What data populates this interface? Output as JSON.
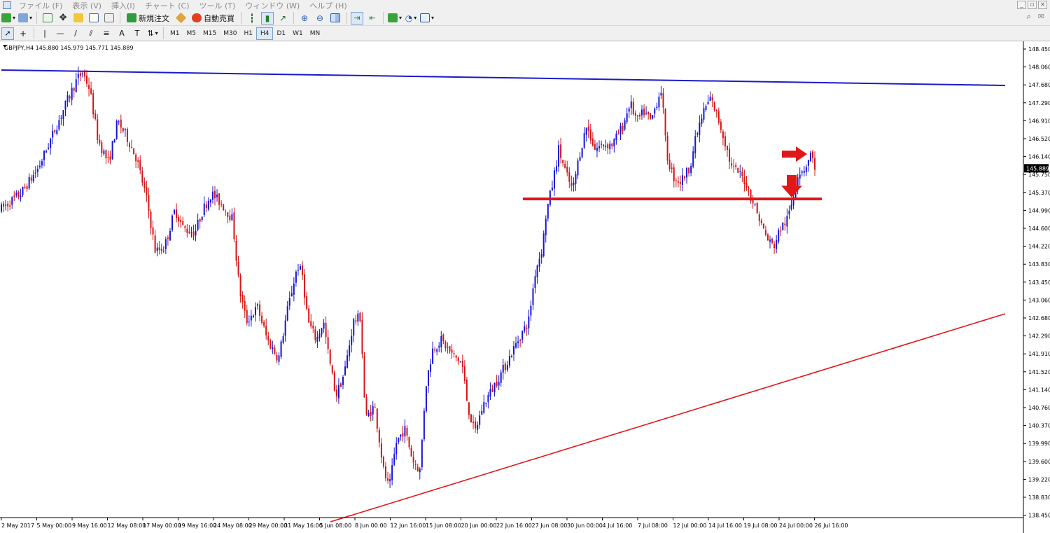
{
  "menu": {
    "items": [
      "ファイル (F)",
      "表示 (V)",
      "挿入(I)",
      "チャート (C)",
      "ツール (T)",
      "ウィンドウ (W)",
      "ヘルプ (H)"
    ]
  },
  "toolbar": {
    "new_order_label": "新規注文",
    "auto_trade_label": "自動売買"
  },
  "timeframes": [
    "M1",
    "M5",
    "M15",
    "M30",
    "H1",
    "H4",
    "D1",
    "W1",
    "MN"
  ],
  "active_timeframe": "H4",
  "chart_header": "GBPJPY,H4  145.880 145.979 145.771 145.889",
  "colors": {
    "bull": "#1414d8",
    "bear": "#d41414",
    "resistance_line": "#1a1acc",
    "support_line": "#e01818",
    "horizontal_line": "#e0141c",
    "arrow": "#e01818"
  },
  "chart_data": {
    "type": "candlestick",
    "symbol": "GBPJPY",
    "timeframe": "H4",
    "ohlc": {
      "open": 145.88,
      "high": 145.979,
      "low": 145.771,
      "close": 145.889
    },
    "current_price": "145.889",
    "y_ticks": [
      "148.450",
      "148.060",
      "147.680",
      "147.290",
      "146.910",
      "146.520",
      "146.140",
      "145.750",
      "145.370",
      "144.990",
      "144.600",
      "144.220",
      "143.830",
      "143.450",
      "143.060",
      "142.680",
      "142.290",
      "141.910",
      "141.520",
      "141.140",
      "140.760",
      "140.370",
      "139.990",
      "139.600",
      "139.220",
      "138.830",
      "138.450"
    ],
    "x_labels": [
      "2 May 2017",
      "5 May 00:00",
      "9 May 16:00",
      "12 May 08:00",
      "17 May 00:00",
      "19 May 16:00",
      "24 May 08:00",
      "29 May 00:00",
      "31 May 16:00",
      "5 Jun 08:00",
      "8 Jun 00:00",
      "12 Jun 16:00",
      "15 Jun 08:00",
      "20 Jun 00:00",
      "22 Jun 16:00",
      "27 Jun 08:00",
      "30 Jun 00:00",
      "4 Jul 16:00",
      "7 Jul 08:00",
      "12 Jul 00:00",
      "14 Jul 16:00",
      "19 Jul 08:00",
      "24 Jul 00:00",
      "26 Jul 16:00"
    ],
    "y_range": [
      138.45,
      148.45
    ],
    "price_path": [
      [
        0,
        145.0
      ],
      [
        30,
        145.35
      ],
      [
        55,
        145.9
      ],
      [
        75,
        146.6
      ],
      [
        95,
        147.3
      ],
      [
        110,
        147.8
      ],
      [
        118,
        147.95
      ],
      [
        128,
        147.6
      ],
      [
        140,
        146.5
      ],
      [
        155,
        146.0
      ],
      [
        168,
        146.9
      ],
      [
        180,
        146.6
      ],
      [
        195,
        146.1
      ],
      [
        210,
        145.2
      ],
      [
        222,
        144.1
      ],
      [
        235,
        144.2
      ],
      [
        250,
        145.0
      ],
      [
        262,
        144.6
      ],
      [
        278,
        144.5
      ],
      [
        290,
        145.0
      ],
      [
        302,
        145.35
      ],
      [
        318,
        145.1
      ],
      [
        332,
        144.8
      ],
      [
        342,
        143.3
      ],
      [
        352,
        142.6
      ],
      [
        368,
        142.9
      ],
      [
        382,
        142.2
      ],
      [
        398,
        141.8
      ],
      [
        410,
        142.8
      ],
      [
        425,
        143.8
      ],
      [
        432,
        143.6
      ],
      [
        440,
        142.6
      ],
      [
        452,
        142.2
      ],
      [
        462,
        142.6
      ],
      [
        470,
        141.8
      ],
      [
        480,
        141.0
      ],
      [
        492,
        141.5
      ],
      [
        505,
        142.6
      ],
      [
        515,
        142.7
      ],
      [
        522,
        140.5
      ],
      [
        535,
        140.8
      ],
      [
        548,
        139.4
      ],
      [
        556,
        139.0
      ],
      [
        566,
        140.0
      ],
      [
        578,
        140.3
      ],
      [
        590,
        139.6
      ],
      [
        600,
        139.4
      ],
      [
        608,
        141.2
      ],
      [
        618,
        142.0
      ],
      [
        630,
        142.2
      ],
      [
        645,
        141.9
      ],
      [
        660,
        141.7
      ],
      [
        668,
        140.8
      ],
      [
        678,
        140.2
      ],
      [
        690,
        140.8
      ],
      [
        705,
        141.2
      ],
      [
        720,
        141.6
      ],
      [
        740,
        142.2
      ],
      [
        755,
        142.6
      ],
      [
        765,
        143.7
      ],
      [
        775,
        144.2
      ],
      [
        780,
        144.9
      ],
      [
        790,
        145.6
      ],
      [
        798,
        146.3
      ],
      [
        808,
        145.8
      ],
      [
        818,
        145.4
      ],
      [
        828,
        146.2
      ],
      [
        838,
        146.8
      ],
      [
        850,
        146.3
      ],
      [
        862,
        146.4
      ],
      [
        875,
        146.4
      ],
      [
        890,
        146.8
      ],
      [
        900,
        147.3
      ],
      [
        910,
        146.9
      ],
      [
        920,
        147.1
      ],
      [
        930,
        146.9
      ],
      [
        940,
        147.4
      ],
      [
        945,
        147.6
      ],
      [
        952,
        146.2
      ],
      [
        962,
        145.7
      ],
      [
        972,
        145.6
      ],
      [
        985,
        145.9
      ],
      [
        995,
        146.6
      ],
      [
        1005,
        147.1
      ],
      [
        1015,
        147.4
      ],
      [
        1025,
        147.0
      ],
      [
        1035,
        146.5
      ],
      [
        1045,
        145.9
      ],
      [
        1055,
        145.8
      ],
      [
        1065,
        145.6
      ],
      [
        1075,
        145.2
      ],
      [
        1085,
        144.8
      ],
      [
        1095,
        144.4
      ],
      [
        1105,
        144.2
      ],
      [
        1115,
        144.6
      ],
      [
        1125,
        144.8
      ],
      [
        1132,
        145.2
      ],
      [
        1140,
        145.8
      ],
      [
        1150,
        145.9
      ],
      [
        1158,
        146.2
      ],
      [
        1165,
        145.889
      ]
    ]
  }
}
